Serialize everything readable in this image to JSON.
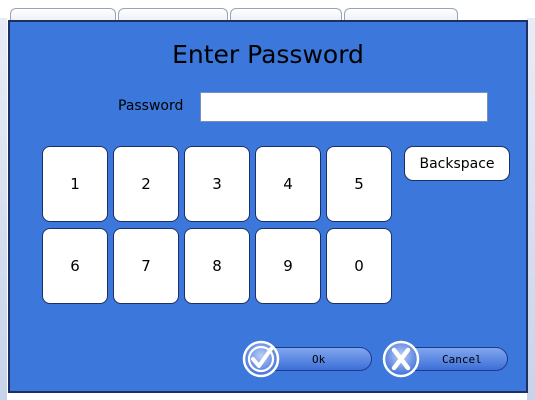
{
  "dialog": {
    "title": "Enter Password",
    "password_label": "Password",
    "password_value": "",
    "backspace_label": "Backspace",
    "ok_label": "Ok",
    "cancel_label": "Cancel"
  },
  "keypad": {
    "row1": [
      "1",
      "2",
      "3",
      "4",
      "5"
    ],
    "row2": [
      "6",
      "7",
      "8",
      "9",
      "0"
    ]
  },
  "colors": {
    "dialog_bg": "#3c78dc",
    "border": "#1e2f66",
    "key_bg": "#ffffff"
  },
  "icons": {
    "ok": "check-icon",
    "cancel": "x-icon"
  }
}
